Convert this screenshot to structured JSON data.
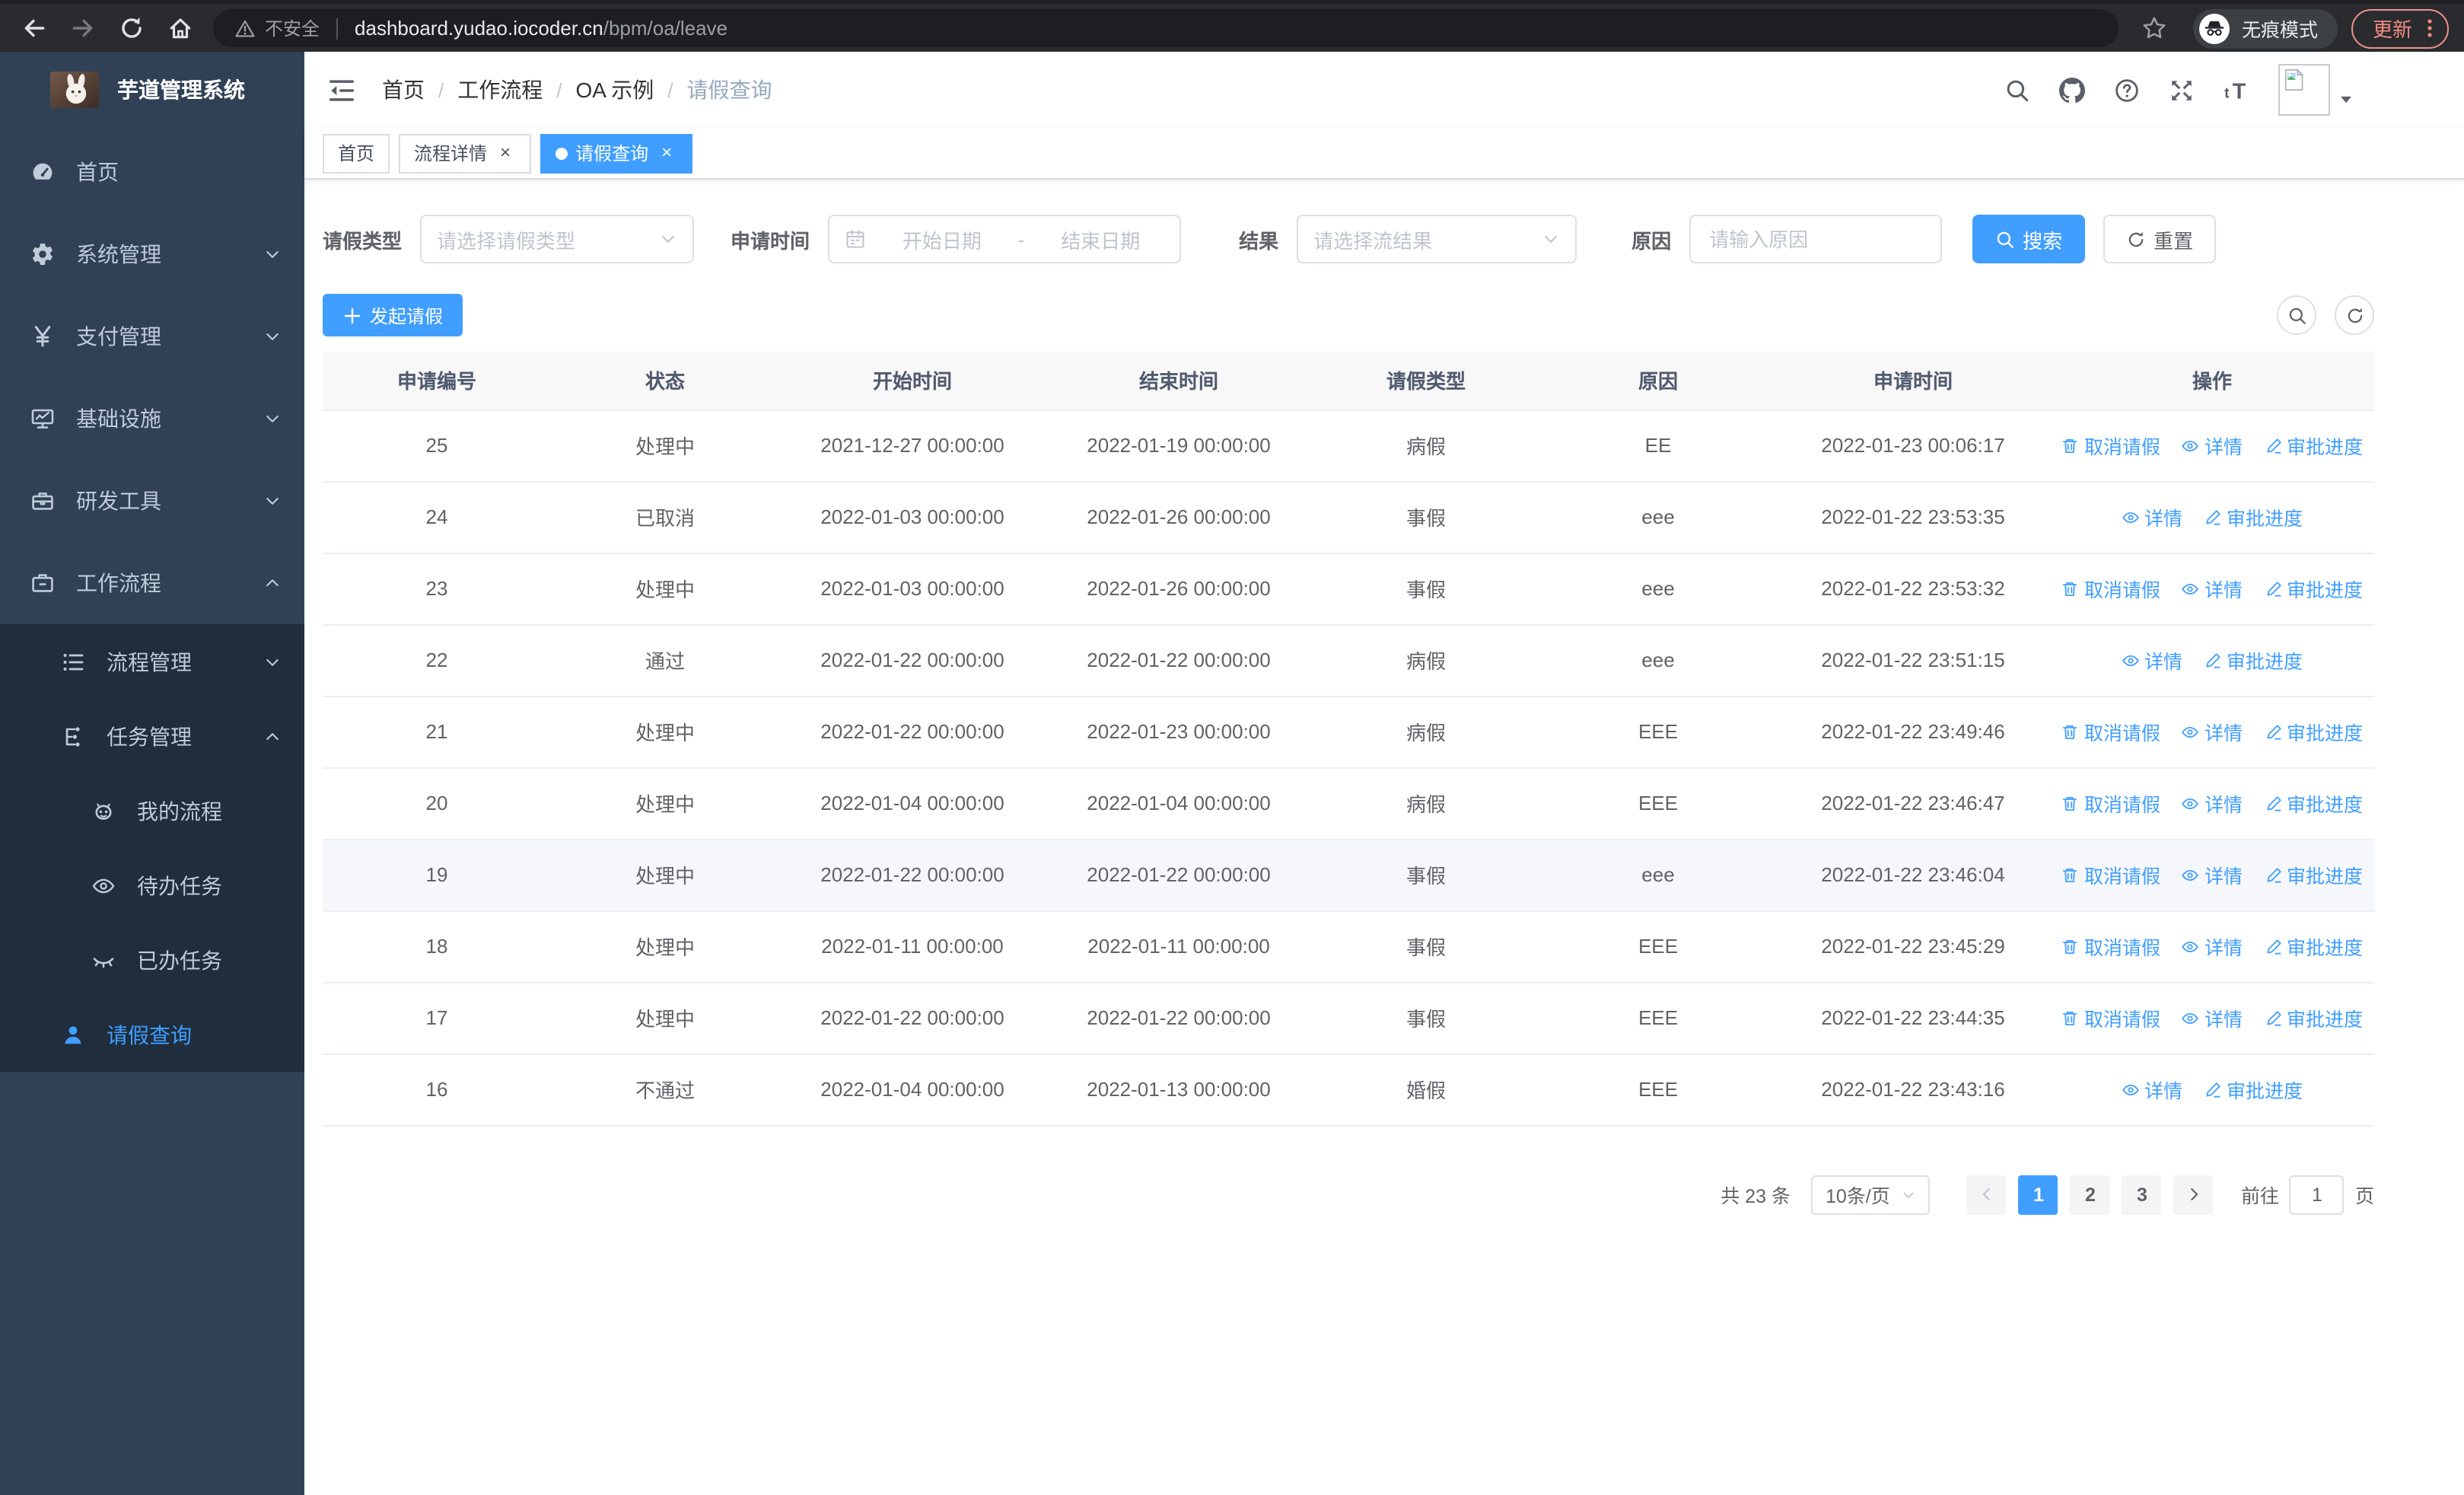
{
  "browser": {
    "security_label": "不安全",
    "url_domain": "dashboard.yudao.iocoder.cn",
    "url_path": "/bpm/oa/leave",
    "incognito_label": "无痕模式",
    "update_label": "更新"
  },
  "sidebar": {
    "title": "芋道管理系统",
    "items": [
      {
        "label": "首页",
        "icon": "dashboard",
        "level": 1
      },
      {
        "label": "系统管理",
        "icon": "gear",
        "level": 1,
        "chevron": "down"
      },
      {
        "label": "支付管理",
        "icon": "yen",
        "level": 1,
        "chevron": "down"
      },
      {
        "label": "基础设施",
        "icon": "monitor",
        "level": 1,
        "chevron": "down"
      },
      {
        "label": "研发工具",
        "icon": "toolbox",
        "level": 1,
        "chevron": "down"
      },
      {
        "label": "工作流程",
        "icon": "briefcase",
        "level": 1,
        "chevron": "up"
      },
      {
        "label": "流程管理",
        "icon": "list",
        "level": 2,
        "chevron": "down",
        "group": true
      },
      {
        "label": "任务管理",
        "icon": "tree",
        "level": 2,
        "chevron": "up",
        "group": true
      },
      {
        "label": "我的流程",
        "icon": "robot",
        "level": 3,
        "group": true
      },
      {
        "label": "待办任务",
        "icon": "eye",
        "level": 3,
        "group": true
      },
      {
        "label": "已办任务",
        "icon": "eye-closed",
        "level": 3,
        "group": true
      },
      {
        "label": "请假查询",
        "icon": "user",
        "level": 2,
        "group": true,
        "active": true
      }
    ]
  },
  "navbar": {
    "breadcrumb": [
      {
        "label": "首页"
      },
      {
        "label": "工作流程"
      },
      {
        "label": "OA 示例"
      },
      {
        "label": "请假查询",
        "muted": true
      }
    ]
  },
  "tabs": [
    {
      "label": "首页"
    },
    {
      "label": "流程详情",
      "closable": true
    },
    {
      "label": "请假查询",
      "closable": true,
      "active": true
    }
  ],
  "filters": {
    "leave_type": {
      "label": "请假类型",
      "placeholder": "请选择请假类型"
    },
    "apply_time": {
      "label": "申请时间",
      "start_placeholder": "开始日期",
      "separator": "-",
      "end_placeholder": "结束日期"
    },
    "result": {
      "label": "结果",
      "placeholder": "请选择流结果"
    },
    "reason": {
      "label": "原因",
      "placeholder": "请输入原因"
    },
    "search_label": "搜索",
    "reset_label": "重置"
  },
  "toolbar": {
    "create_label": "发起请假"
  },
  "table": {
    "columns": [
      "申请编号",
      "状态",
      "开始时间",
      "结束时间",
      "请假类型",
      "原因",
      "申请时间",
      "操作"
    ],
    "action_labels": {
      "cancel": "取消请假",
      "detail": "详情",
      "progress": "审批进度"
    },
    "rows": [
      {
        "id": "25",
        "status": "处理中",
        "start": "2021-12-27 00:00:00",
        "end": "2022-01-19 00:00:00",
        "type": "病假",
        "reason": "EE",
        "apply": "2022-01-23 00:06:17",
        "actions": [
          "cancel",
          "detail",
          "progress"
        ]
      },
      {
        "id": "24",
        "status": "已取消",
        "start": "2022-01-03 00:00:00",
        "end": "2022-01-26 00:00:00",
        "type": "事假",
        "reason": "eee",
        "apply": "2022-01-22 23:53:35",
        "actions": [
          "detail",
          "progress"
        ]
      },
      {
        "id": "23",
        "status": "处理中",
        "start": "2022-01-03 00:00:00",
        "end": "2022-01-26 00:00:00",
        "type": "事假",
        "reason": "eee",
        "apply": "2022-01-22 23:53:32",
        "actions": [
          "cancel",
          "detail",
          "progress"
        ]
      },
      {
        "id": "22",
        "status": "通过",
        "start": "2022-01-22 00:00:00",
        "end": "2022-01-22 00:00:00",
        "type": "病假",
        "reason": "eee",
        "apply": "2022-01-22 23:51:15",
        "actions": [
          "detail",
          "progress"
        ]
      },
      {
        "id": "21",
        "status": "处理中",
        "start": "2022-01-22 00:00:00",
        "end": "2022-01-23 00:00:00",
        "type": "病假",
        "reason": "EEE",
        "apply": "2022-01-22 23:49:46",
        "actions": [
          "cancel",
          "detail",
          "progress"
        ]
      },
      {
        "id": "20",
        "status": "处理中",
        "start": "2022-01-04 00:00:00",
        "end": "2022-01-04 00:00:00",
        "type": "病假",
        "reason": "EEE",
        "apply": "2022-01-22 23:46:47",
        "actions": [
          "cancel",
          "detail",
          "progress"
        ]
      },
      {
        "id": "19",
        "status": "处理中",
        "start": "2022-01-22 00:00:00",
        "end": "2022-01-22 00:00:00",
        "type": "事假",
        "reason": "eee",
        "apply": "2022-01-22 23:46:04",
        "actions": [
          "cancel",
          "detail",
          "progress"
        ],
        "highlighted": true
      },
      {
        "id": "18",
        "status": "处理中",
        "start": "2022-01-11 00:00:00",
        "end": "2022-01-11 00:00:00",
        "type": "事假",
        "reason": "EEE",
        "apply": "2022-01-22 23:45:29",
        "actions": [
          "cancel",
          "detail",
          "progress"
        ]
      },
      {
        "id": "17",
        "status": "处理中",
        "start": "2022-01-22 00:00:00",
        "end": "2022-01-22 00:00:00",
        "type": "事假",
        "reason": "EEE",
        "apply": "2022-01-22 23:44:35",
        "actions": [
          "cancel",
          "detail",
          "progress"
        ]
      },
      {
        "id": "16",
        "status": "不通过",
        "start": "2022-01-04 00:00:00",
        "end": "2022-01-13 00:00:00",
        "type": "婚假",
        "reason": "EEE",
        "apply": "2022-01-22 23:43:16",
        "actions": [
          "detail",
          "progress"
        ]
      }
    ]
  },
  "pagination": {
    "total_text": "共 23 条",
    "page_size": "10条/页",
    "pages": [
      "1",
      "2",
      "3"
    ],
    "active_page": "1",
    "goto_label": "前往",
    "goto_value": "1",
    "goto_suffix": "页"
  },
  "colors": {
    "primary": "#409eff",
    "sidebar_bg": "#304156",
    "submenu_bg": "#1f2d3d",
    "update_badge": "#f28b82"
  }
}
